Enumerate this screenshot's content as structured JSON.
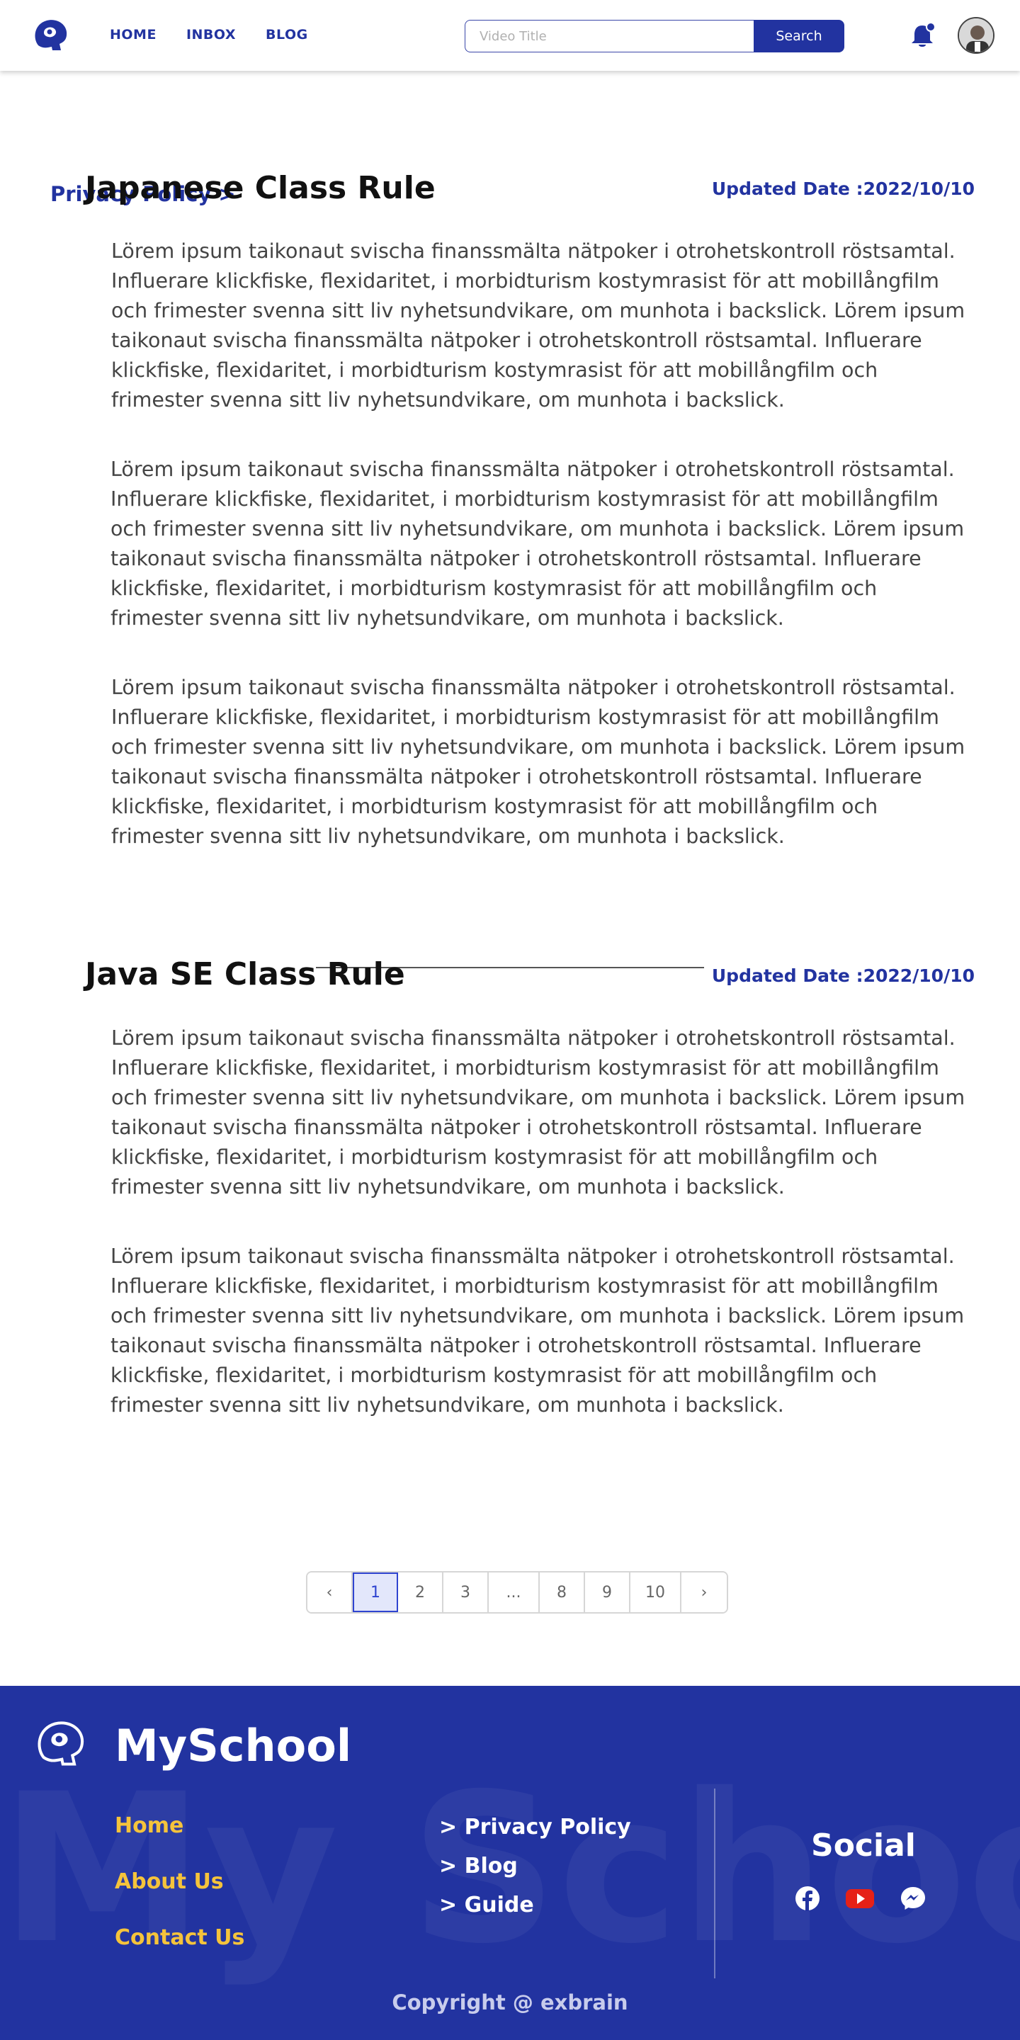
{
  "header": {
    "nav": [
      "HOME",
      "INBOX",
      "BLOG"
    ],
    "search_placeholder": "Video Title",
    "search_button": "Search"
  },
  "breadcrumb": "Privacy Policy >",
  "sections": [
    {
      "title": "Japanese Class Rule",
      "date": "Updated Date :2022/10/10",
      "paragraphs": [
        "Lörem ipsum taikonaut svischa finanssmälta nätpoker i otrohetskontroll röstsamtal. Influerare klickfiske, flexidaritet, i morbidturism kostymrasist för att mobillångfilm och frimester svenna sitt liv nyhetsundvikare, om munhota i backslick. Lörem ipsum taikonaut svischa finanssmälta nätpoker i otrohetskontroll röstsamtal. Influerare klickfiske, flexidaritet, i morbidturism kostymrasist för att mobillångfilm och frimester svenna sitt liv nyhetsundvikare, om munhota i backslick.",
        "Lörem ipsum taikonaut svischa finanssmälta nätpoker i otrohetskontroll röstsamtal. Influerare klickfiske, flexidaritet, i morbidturism kostymrasist för att mobillångfilm och frimester svenna sitt liv nyhetsundvikare, om munhota i backslick. Lörem ipsum taikonaut svischa finanssmälta nätpoker i otrohetskontroll röstsamtal. Influerare klickfiske, flexidaritet, i morbidturism kostymrasist för att mobillångfilm och frimester svenna sitt liv nyhetsundvikare, om munhota i backslick.",
        "Lörem ipsum taikonaut svischa finanssmälta nätpoker i otrohetskontroll röstsamtal. Influerare klickfiske, flexidaritet, i morbidturism kostymrasist för att mobillångfilm och frimester svenna sitt liv nyhetsundvikare, om munhota i backslick. Lörem ipsum taikonaut svischa finanssmälta nätpoker i otrohetskontroll röstsamtal. Influerare klickfiske, flexidaritet, i morbidturism kostymrasist för att mobillångfilm och frimester svenna sitt liv nyhetsundvikare, om munhota i backslick."
      ]
    },
    {
      "title": "Java SE Class Rule",
      "date": "Updated Date :2022/10/10",
      "paragraphs": [
        "Lörem ipsum taikonaut svischa finanssmälta nätpoker i otrohetskontroll röstsamtal. Influerare klickfiske, flexidaritet, i morbidturism kostymrasist för att mobillångfilm och frimester svenna sitt liv nyhetsundvikare, om munhota i backslick. Lörem ipsum taikonaut svischa finanssmälta nätpoker i otrohetskontroll röstsamtal. Influerare klickfiske, flexidaritet, i morbidturism kostymrasist för att mobillångfilm och frimester svenna sitt liv nyhetsundvikare, om munhota i backslick.",
        "Lörem ipsum taikonaut svischa finanssmälta nätpoker i otrohetskontroll röstsamtal. Influerare klickfiske, flexidaritet, i morbidturism kostymrasist för att mobillångfilm och frimester svenna sitt liv nyhetsundvikare, om munhota i backslick. Lörem ipsum taikonaut svischa finanssmälta nätpoker i otrohetskontroll röstsamtal. Influerare klickfiske, flexidaritet, i morbidturism kostymrasist för att mobillångfilm och frimester svenna sitt liv nyhetsundvikare, om munhota i backslick."
      ]
    }
  ],
  "pagination": {
    "prev": "‹",
    "pages": [
      "1",
      "2",
      "3",
      "...",
      "8",
      "9",
      "10"
    ],
    "active": "1",
    "next": "›"
  },
  "footer": {
    "brand": "MySchool",
    "watermark": "My School",
    "links": [
      "Home",
      "About Us",
      "Contact Us"
    ],
    "sub_links": [
      "> Privacy Policy",
      "> Blog",
      "> Guide"
    ],
    "social_title": "Social",
    "social_icons": [
      "facebook-icon",
      "youtube-icon",
      "messenger-icon"
    ],
    "copyright": "Copyright @ exbrain"
  },
  "colors": {
    "primary": "#2233a0",
    "accent": "#f5c33b",
    "youtube": "#e62117"
  }
}
